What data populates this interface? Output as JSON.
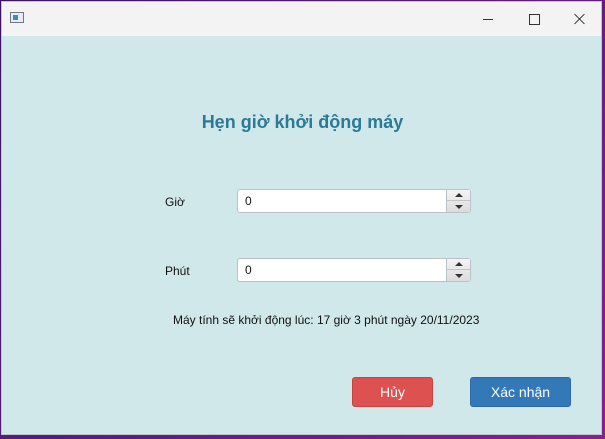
{
  "window": {
    "controls": {
      "minimize_icon": "minimize-icon",
      "maximize_icon": "maximize-icon",
      "close_icon": "close-icon"
    },
    "background": "#d0e8ea"
  },
  "form": {
    "title": "Hẹn giờ khởi động máy",
    "title_color": "#2a7a98",
    "hour": {
      "label": "Giờ",
      "value": "0"
    },
    "minute": {
      "label": "Phút",
      "value": "0"
    },
    "status_text": "Máy tính sẽ khởi động lúc: 17 giờ 3 phút ngày 20/11/2023"
  },
  "actions": {
    "cancel_label": "Hủy",
    "cancel_color": "#dd5150",
    "confirm_label": "Xác nhận",
    "confirm_color": "#3378b7"
  }
}
